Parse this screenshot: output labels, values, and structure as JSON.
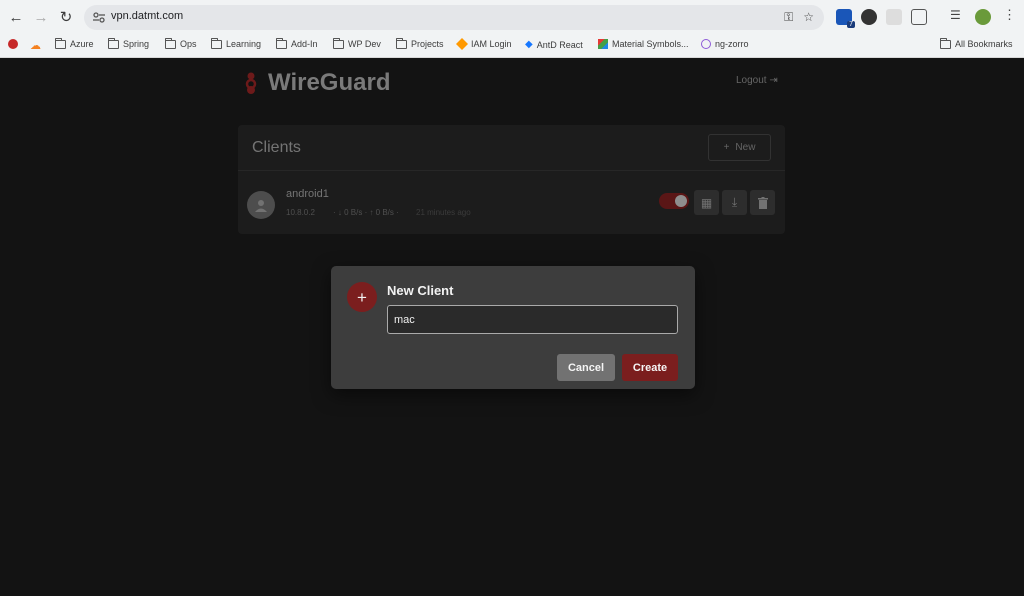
{
  "browser": {
    "url": "vpn.datmt.com",
    "extension_badge": "7",
    "bookmarks": [
      {
        "label": "Azure",
        "icon": "folder-icon"
      },
      {
        "label": "Spring",
        "icon": "folder-icon"
      },
      {
        "label": "Ops",
        "icon": "folder-icon"
      },
      {
        "label": "Learning",
        "icon": "folder-icon"
      },
      {
        "label": "Add-In",
        "icon": "folder-icon"
      },
      {
        "label": "WP Dev",
        "icon": "folder-icon"
      },
      {
        "label": "Projects",
        "icon": "folder-icon"
      },
      {
        "label": "IAM Login",
        "icon": "aws-cube-icon"
      },
      {
        "label": "AntD React",
        "icon": "antd-icon"
      },
      {
        "label": "Material Symbols...",
        "icon": "material-icon"
      },
      {
        "label": "ng-zorro",
        "icon": "ng-zorro-icon"
      }
    ],
    "all_bookmarks": "All Bookmarks"
  },
  "app": {
    "name": "WireGuard",
    "logout": "Logout",
    "accent": "#7b1e1e"
  },
  "clients_panel": {
    "title": "Clients",
    "new_button": "New",
    "clients": [
      {
        "name": "android1",
        "ip": "10.8.0.2",
        "stats": "· ↓ 0 B/s · ↑ 0 B/s ·",
        "last_seen": "21 minutes ago",
        "enabled": true
      }
    ]
  },
  "modal": {
    "title": "New Client",
    "input_value": "mac",
    "cancel_label": "Cancel",
    "create_label": "Create"
  }
}
